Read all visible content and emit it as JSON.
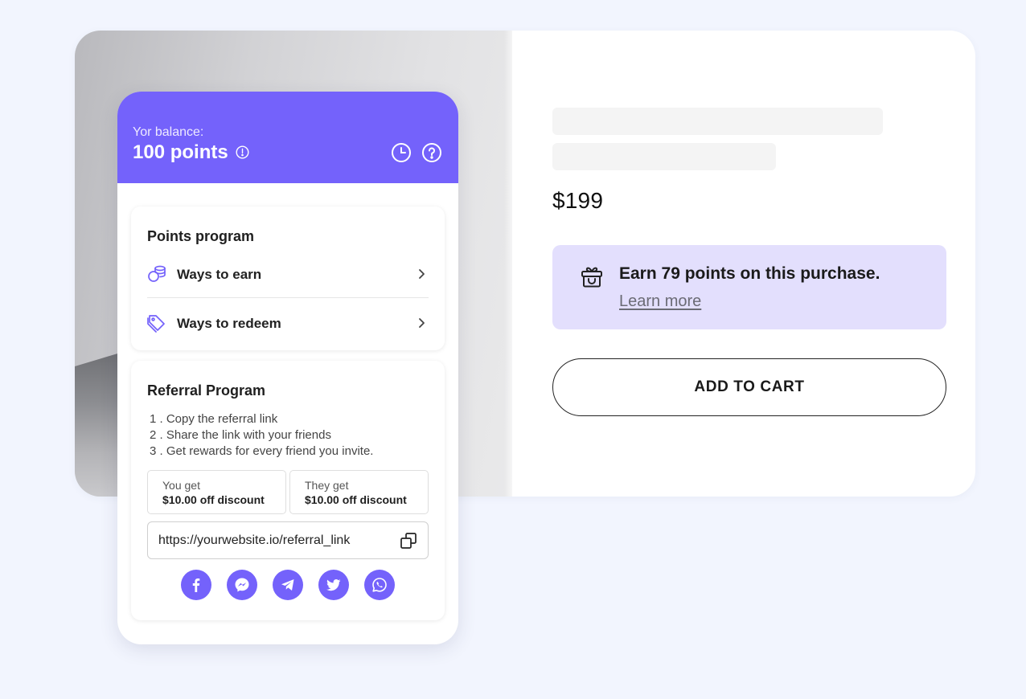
{
  "product": {
    "price": "$199",
    "earn_points_text": "Earn 79 points on this purchase.",
    "learn_more": "Learn more",
    "add_to_cart": "ADD TO CART"
  },
  "widget": {
    "balance_label": "Yor balance:",
    "balance_value": "100 points",
    "points_program": {
      "title": "Points program",
      "items": [
        {
          "label": "Ways to earn",
          "icon": "coins-icon"
        },
        {
          "label": "Ways to redeem",
          "icon": "tag-icon"
        }
      ]
    },
    "referral_program": {
      "title": "Referral Program",
      "steps": [
        "1 . Copy the referral link",
        "2 . Share the link with your friends",
        "3 . Get rewards for every friend you invite."
      ],
      "you_get_label": "You get",
      "you_get_value": "$10.00 off discount",
      "they_get_label": "They get",
      "they_get_value": "$10.00 off discount",
      "referral_link": "https://yourwebsite.io/referral_link",
      "socials": [
        "facebook-icon",
        "messenger-icon",
        "telegram-icon",
        "twitter-icon",
        "whatsapp-icon"
      ]
    }
  },
  "colors": {
    "accent": "#7462fb",
    "earn_box_bg": "#e3dffd",
    "page_bg": "#f2f5fe"
  }
}
